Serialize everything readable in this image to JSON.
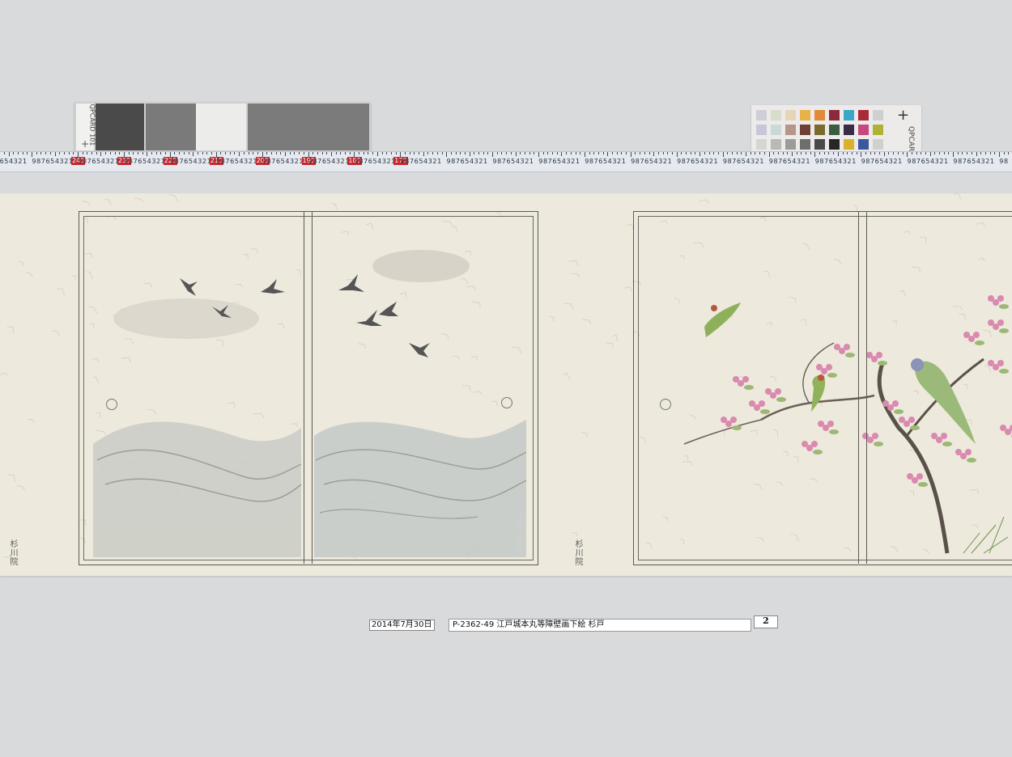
{
  "gray_card": {
    "brand": "QPCARD 101"
  },
  "color_card": {
    "brand": "QPCARD",
    "patches": [
      "#cfcdd6",
      "#d9dccb",
      "#e5d5b6",
      "#e7b248",
      "#e08a3a",
      "#8b2a3a",
      "#3aa7c7",
      "#a92b37",
      "#cfcfd2",
      "#c9c6d8",
      "#c8d9d7",
      "#b79689",
      "#6e3f34",
      "#7a6a2c",
      "#3a5d3f",
      "#3a2b45",
      "#c7477f",
      "#b0b235",
      "#d5d5d3",
      "#b9b9b7",
      "#9b9b99",
      "#6e6e6c",
      "#4a4a48",
      "#262626",
      "#d9b12b",
      "#3a58a0",
      "#d0d0ce"
    ]
  },
  "ruler": {
    "cm_labels": [
      "240",
      "230",
      "220",
      "210",
      "200",
      "190",
      "180",
      "170"
    ]
  },
  "signature_left": "杉川院",
  "signature_middle": "杉川院",
  "footer": {
    "date": "2014年7月30日",
    "title": "P-2362-49 江戸城本丸等障壁画下絵 杉戸",
    "number": "2"
  }
}
